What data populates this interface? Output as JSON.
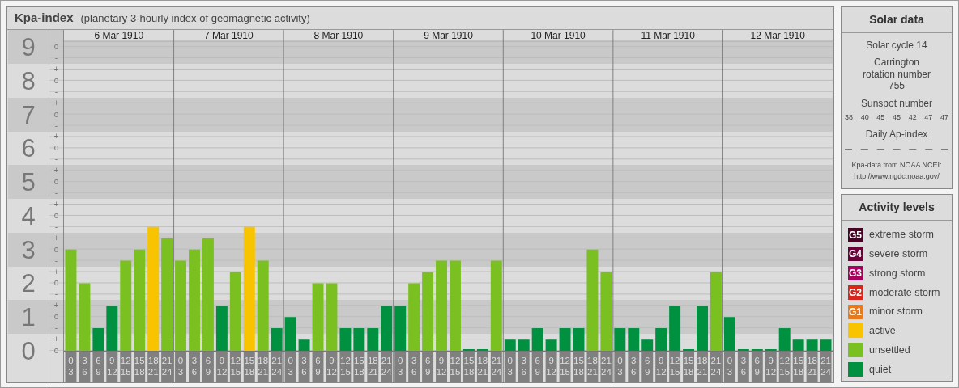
{
  "header": {
    "title": "Kpa-index",
    "subtitle": "(planetary 3-hourly index of geomagnetic activity)"
  },
  "kp_chart": {
    "days": [
      "6 Mar 1910",
      "7 Mar 1910",
      "8 Mar 1910",
      "9 Mar 1910",
      "10 Mar 1910",
      "11 Mar 1910",
      "12 Mar 1910"
    ],
    "y_minor_ticks": [
      "o",
      "-",
      "+",
      "o",
      "-",
      "+",
      "o",
      "-",
      "+",
      "o",
      "-",
      "+",
      "o",
      "-",
      "+",
      "o",
      "-",
      "+",
      "o",
      "-",
      "+",
      "o",
      "-",
      "+",
      "o",
      "-",
      "+",
      "o"
    ],
    "chart_data": {
      "type": "bar",
      "grid": true,
      "categories": [
        "0 3",
        "3 6",
        "6 9",
        "9 12",
        "12 15",
        "15 18",
        "18 21",
        "21 24",
        "0 3",
        "3 6",
        "6 9",
        "9 12",
        "12 15",
        "15 18",
        "18 21",
        "21 24",
        "0 3",
        "3 6",
        "6 9",
        "9 12",
        "12 15",
        "15 18",
        "18 21",
        "21 24",
        "0 3",
        "3 6",
        "6 9",
        "9 12",
        "12 15",
        "15 18",
        "18 21",
        "21 24",
        "0 3",
        "3 6",
        "6 9",
        "9 12",
        "12 15",
        "15 18",
        "18 21",
        "21 24",
        "0 3",
        "3 6",
        "6 9",
        "9 12",
        "12 15",
        "15 18",
        "18 21",
        "21 24",
        "0 3",
        "3 6",
        "6 9",
        "9 12",
        "12 15",
        "15 18",
        "18 21",
        "21 24"
      ],
      "ylim": [
        0,
        9.17
      ],
      "yticks": [
        {
          "value": 9,
          "label": "9"
        },
        {
          "value": 8,
          "label": "8"
        },
        {
          "value": 7,
          "label": "7"
        },
        {
          "value": 6,
          "label": "6"
        },
        {
          "value": 5,
          "label": "5"
        },
        {
          "value": 4,
          "label": "4"
        },
        {
          "value": 3,
          "label": "3"
        },
        {
          "value": 2,
          "label": "2"
        },
        {
          "value": 1,
          "label": "1"
        },
        {
          "value": 0,
          "label": "0"
        }
      ],
      "series": [
        {
          "color": "#009140",
          "values": [
            null,
            null,
            0.67,
            1.33,
            null,
            null,
            null,
            null,
            null,
            null,
            null,
            1.33,
            null,
            null,
            null,
            0.67,
            1,
            0.33,
            null,
            null,
            0.67,
            0.67,
            0.67,
            1.33,
            1.33,
            null,
            null,
            null,
            null,
            0,
            0,
            null,
            0.33,
            0.33,
            0.67,
            0.33,
            0.67,
            0.67,
            null,
            null,
            0.67,
            0.67,
            0.33,
            0.67,
            1.33,
            0,
            1.33,
            null,
            1,
            0,
            0,
            0,
            0.67,
            0.33,
            0.33,
            0.33
          ]
        },
        {
          "color": "#7bc021",
          "values": [
            3,
            2,
            null,
            null,
            2.67,
            3,
            null,
            3.33,
            2.67,
            3,
            3.33,
            null,
            2.33,
            null,
            2.67,
            null,
            null,
            null,
            2,
            2,
            null,
            null,
            null,
            null,
            null,
            2,
            2.33,
            2.67,
            2.67,
            null,
            null,
            2.67,
            null,
            null,
            null,
            null,
            null,
            null,
            3,
            2.33,
            null,
            null,
            null,
            null,
            null,
            null,
            null,
            2.33,
            null,
            null,
            null,
            null,
            null,
            null,
            null,
            null
          ]
        },
        {
          "color": "#f8c400",
          "values": [
            null,
            null,
            null,
            null,
            null,
            null,
            3.67,
            null,
            null,
            null,
            null,
            null,
            null,
            3.67,
            null,
            null,
            null,
            null,
            null,
            null,
            null,
            null,
            null,
            null,
            null,
            null,
            null,
            null,
            null,
            null,
            null,
            null,
            null,
            null,
            null,
            null,
            null,
            null,
            null,
            null,
            null,
            null,
            null,
            null,
            null,
            null,
            null,
            null,
            null,
            null,
            null,
            null,
            null,
            null,
            null,
            null
          ]
        }
      ]
    }
  },
  "solar_data": {
    "title": "Solar data",
    "cycle": "Solar cycle 14",
    "rotation": "Carrington rotation number 755",
    "sunspot_label": "Sunspot number",
    "sunspot_numbers": [
      "38",
      "40",
      "45",
      "45",
      "42",
      "47",
      "47"
    ],
    "ap_label": "Daily Ap-index",
    "ap_values": [
      "—",
      "—",
      "—",
      "—",
      "—",
      "—",
      "—"
    ],
    "source": "Kpa-data from NOAA NCEI:",
    "source_url": "http://www.ngdc.noaa.gov/"
  },
  "legend": {
    "title": "Activity levels",
    "items": [
      {
        "badge": "G5",
        "label": "extreme storm",
        "color": "#4b0026"
      },
      {
        "badge": "G4",
        "label": "severe storm",
        "color": "#6b0038"
      },
      {
        "badge": "G3",
        "label": "strong storm",
        "color": "#a8005f"
      },
      {
        "badge": "G2",
        "label": "moderate storm",
        "color": "#d9261c"
      },
      {
        "badge": "G1",
        "label": "minor storm",
        "color": "#e87a1e"
      },
      {
        "label": "active",
        "color": "#f8c400"
      },
      {
        "label": "unsettled",
        "color": "#7bc021"
      },
      {
        "label": "quiet",
        "color": "#009140"
      }
    ]
  }
}
